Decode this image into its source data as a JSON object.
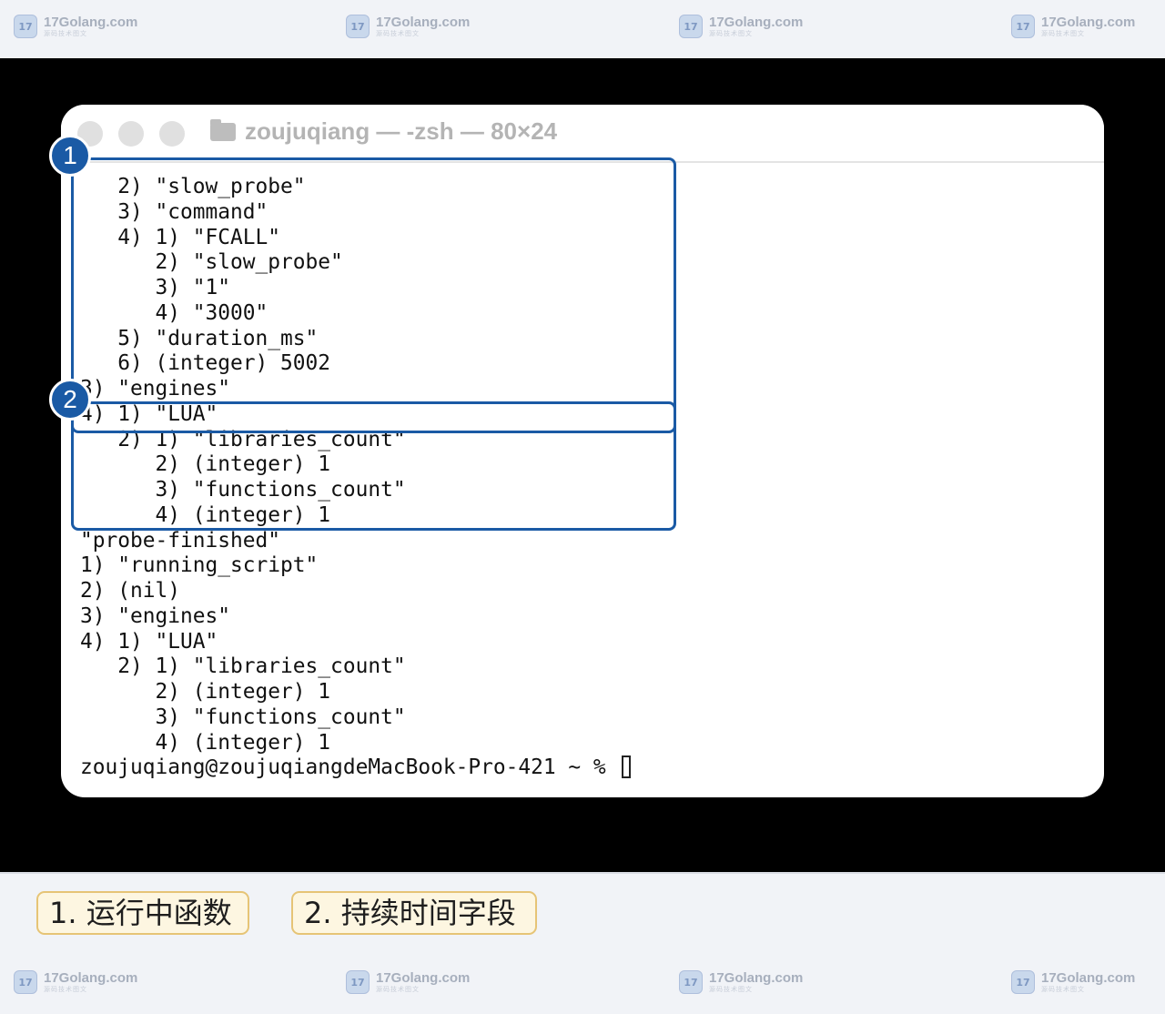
{
  "watermark": {
    "name": "17Golang.com",
    "sub": "源码技术图文",
    "logo": "17"
  },
  "window": {
    "title": "zoujuqiang — -zsh — 80×24",
    "icon": "folder-icon"
  },
  "terminal": {
    "lines": [
      "   2) \"slow_probe\"",
      "   3) \"command\"",
      "   4) 1) \"FCALL\"",
      "      2) \"slow_probe\"",
      "      3) \"1\"",
      "      4) \"3000\"",
      "   5) \"duration_ms\"",
      "   6) (integer) 5002",
      "3) \"engines\"",
      "4) 1) \"LUA\"",
      "   2) 1) \"libraries_count\"",
      "      2) (integer) 1",
      "      3) \"functions_count\"",
      "      4) (integer) 1",
      "\"probe-finished\"",
      "1) \"running_script\"",
      "2) (nil)",
      "3) \"engines\"",
      "4) 1) \"LUA\"",
      "   2) 1) \"libraries_count\"",
      "      2) (integer) 1",
      "      3) \"functions_count\"",
      "      4) (integer) 1"
    ],
    "prompt": "zoujuqiang@zoujuqiangdeMacBook-Pro-421 ~ % "
  },
  "badges": [
    "1",
    "2"
  ],
  "legend": [
    "1. 运行中函数",
    "2. 持续时间字段"
  ],
  "colors": {
    "highlight": "#1a5aa5",
    "legend_border": "#e6c476",
    "legend_bg": "#fdf6e1"
  }
}
